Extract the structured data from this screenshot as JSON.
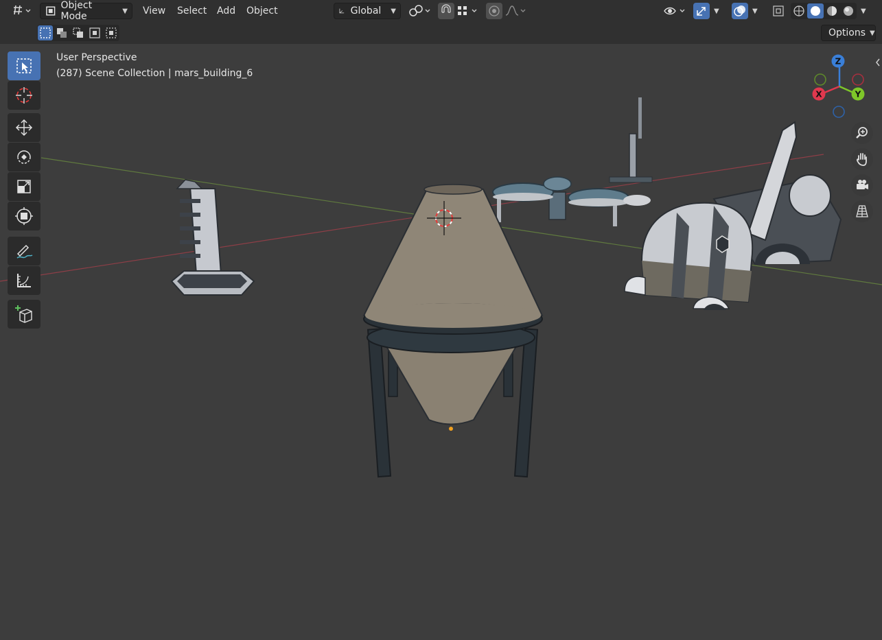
{
  "header": {
    "mode_label": "Object Mode",
    "menus": [
      "View",
      "Select",
      "Add",
      "Object"
    ],
    "transform_orientation": "Global"
  },
  "subheader": {
    "options_label": "Options"
  },
  "viewport": {
    "perspective_label": "User Perspective",
    "collection_label": "(287) Scene Collection | mars_building_6",
    "gizmo": {
      "x": "X",
      "y": "Y",
      "z": "Z"
    },
    "colors": {
      "x_axis": "#e0384e",
      "y_axis": "#7ec629",
      "z_axis": "#3a7fd8",
      "active_tool": "#4772b3"
    }
  },
  "toolbar": {
    "tools": [
      "select-box",
      "cursor",
      "move",
      "rotate",
      "scale",
      "transform",
      "annotate",
      "measure",
      "add-cube"
    ]
  }
}
